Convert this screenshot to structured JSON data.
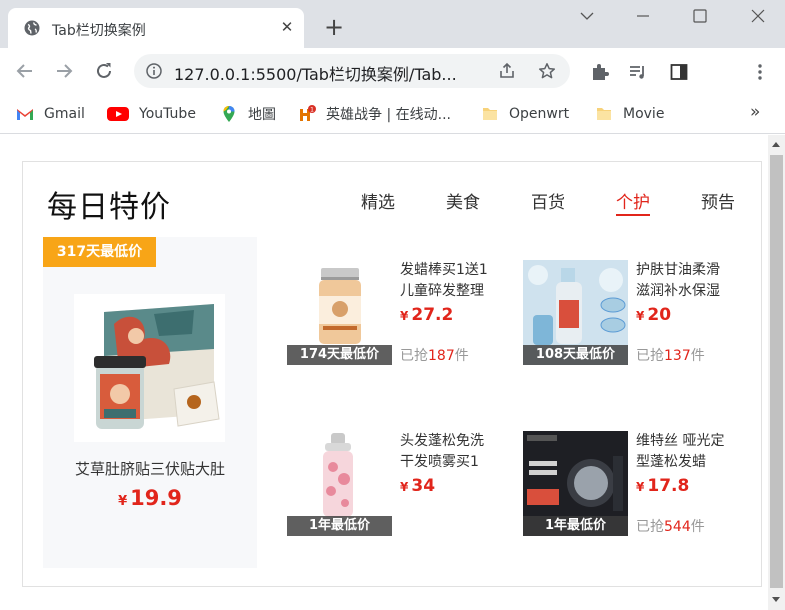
{
  "browser": {
    "tab_title": "Tab栏切换案例",
    "url_host": "127.0.0.1",
    "url_rest": ":5500/Tab栏切换案例/Tab...",
    "bookmarks": [
      {
        "label": "Gmail",
        "icon": "gmail-icon"
      },
      {
        "label": "YouTube",
        "icon": "youtube-icon"
      },
      {
        "label": "地圖",
        "icon": "maps-icon"
      },
      {
        "label": "英雄战争 | 在线动...",
        "icon": "hero-icon"
      },
      {
        "label": "Openwrt",
        "icon": "folder-icon"
      },
      {
        "label": "Movie",
        "icon": "folder-icon"
      }
    ]
  },
  "page": {
    "title": "每日特价",
    "tabs": [
      {
        "label": "精选",
        "active": false
      },
      {
        "label": "美食",
        "active": false
      },
      {
        "label": "百货",
        "active": false
      },
      {
        "label": "个护",
        "active": true
      },
      {
        "label": "预告",
        "active": false
      }
    ],
    "featured": {
      "badge": "317天最低价",
      "name": "艾草肚脐贴三伏贴大肚",
      "currency": "¥",
      "price": "19.9"
    },
    "products": [
      {
        "name": "发蜡棒买1送1儿童碎发整理",
        "currency": "¥",
        "price": "27.2",
        "ribbon": "174天最低价",
        "sold_prefix": "已抢",
        "sold_num": "187",
        "sold_suffix": "件"
      },
      {
        "name": "护肤甘油柔滑滋润补水保湿",
        "currency": "¥",
        "price": "20",
        "ribbon": "108天最低价",
        "sold_prefix": "已抢",
        "sold_num": "137",
        "sold_suffix": "件"
      },
      {
        "name": "头发蓬松免洗干发喷雾买1",
        "currency": "¥",
        "price": "34",
        "ribbon": "1年最低价",
        "sold_prefix": "",
        "sold_num": "",
        "sold_suffix": ""
      },
      {
        "name": "维特丝 哑光定型蓬松发蜡",
        "currency": "¥",
        "price": "17.8",
        "ribbon": "1年最低价",
        "sold_prefix": "已抢",
        "sold_num": "544",
        "sold_suffix": "件"
      }
    ]
  },
  "colors": {
    "accent_red": "#e1251b",
    "badge_orange": "#f8a517"
  }
}
